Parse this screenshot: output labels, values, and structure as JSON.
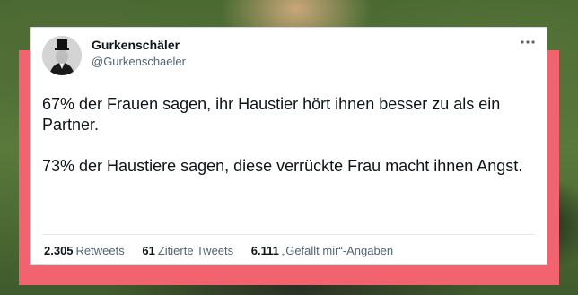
{
  "tweet": {
    "display_name": "Gurkenschäler",
    "handle": "@Gurkenschaeler",
    "paragraphs": [
      "67% der Frauen sagen, ihr Haustier hört ihnen besser zu als ein Partner.",
      "73% der Haustiere sagen, diese verrückte Frau macht ihnen Angst."
    ],
    "stats": {
      "retweets_count": "2.305",
      "retweets_label": "Retweets",
      "quotes_count": "61",
      "quotes_label": "Zitierte Tweets",
      "likes_count": "6.111",
      "likes_label": "„Gefällt mir“-Angaben"
    }
  },
  "icons": {
    "avatar": "top-hat-portrait",
    "more": "more-dots-icon"
  },
  "colors": {
    "frame": "#f1646f",
    "card": "#ffffff",
    "text": "#0f1419",
    "muted": "#536471"
  }
}
